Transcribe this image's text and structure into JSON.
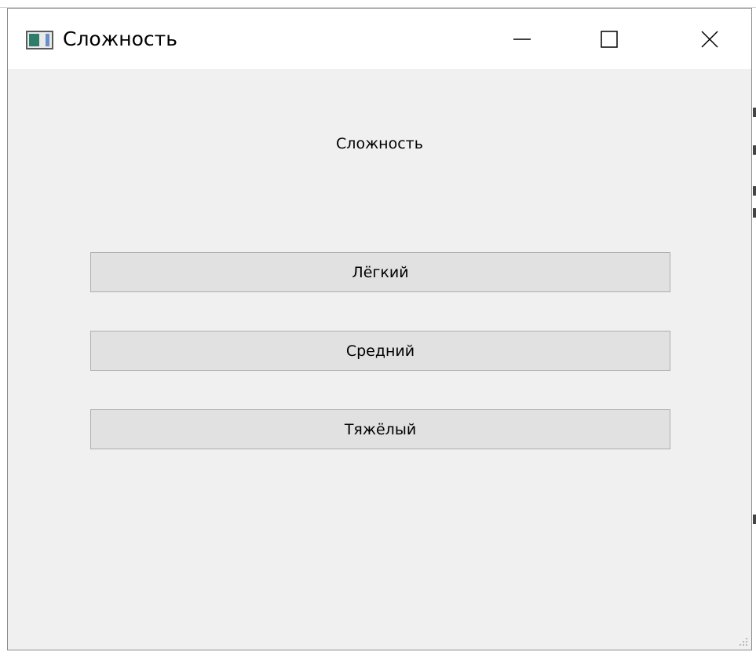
{
  "window": {
    "title": "Сложность",
    "icon": "app-window-icon",
    "controls": {
      "minimize_icon": "minimize-icon",
      "maximize_icon": "maximize-icon",
      "close_icon": "close-icon"
    }
  },
  "content": {
    "heading": "Сложность",
    "buttons": [
      {
        "label": "Лёгкий"
      },
      {
        "label": "Средний"
      },
      {
        "label": "Тяжёлый"
      }
    ]
  },
  "colors": {
    "client_background": "#f0f0f0",
    "button_background": "#e1e1e1",
    "button_border": "#adadad",
    "titlebar_background": "#ffffff"
  }
}
